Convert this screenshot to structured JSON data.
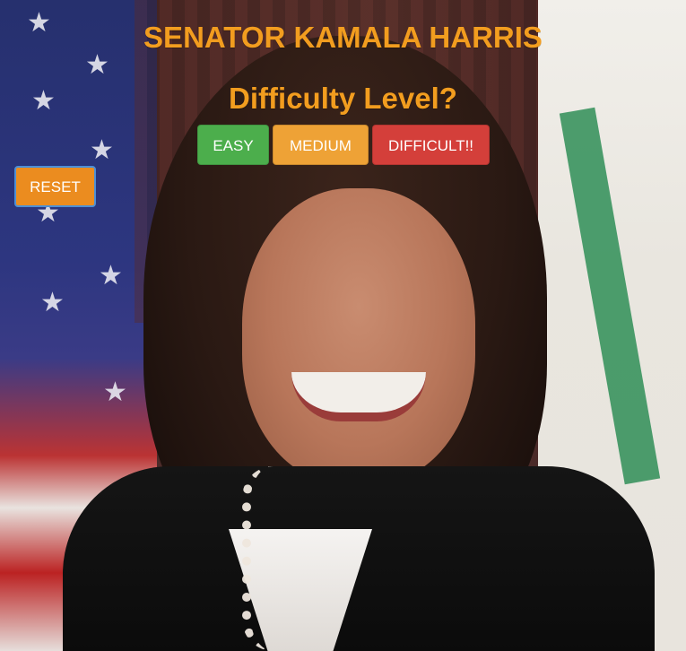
{
  "header": {
    "title": "SENATOR KAMALA HARRIS",
    "subtitle": "Difficulty Level?"
  },
  "difficulty": {
    "buttons": [
      {
        "label": "EASY",
        "color": "#4cae4c"
      },
      {
        "label": "MEDIUM",
        "color": "#eea236"
      },
      {
        "label": "DIFFICULT!!",
        "color": "#d43f3a"
      }
    ]
  },
  "controls": {
    "reset_label": "RESET",
    "reset_color": "#eb8c1f"
  },
  "colors": {
    "accent": "#f29d1f"
  },
  "icons": {
    "star": "★"
  }
}
